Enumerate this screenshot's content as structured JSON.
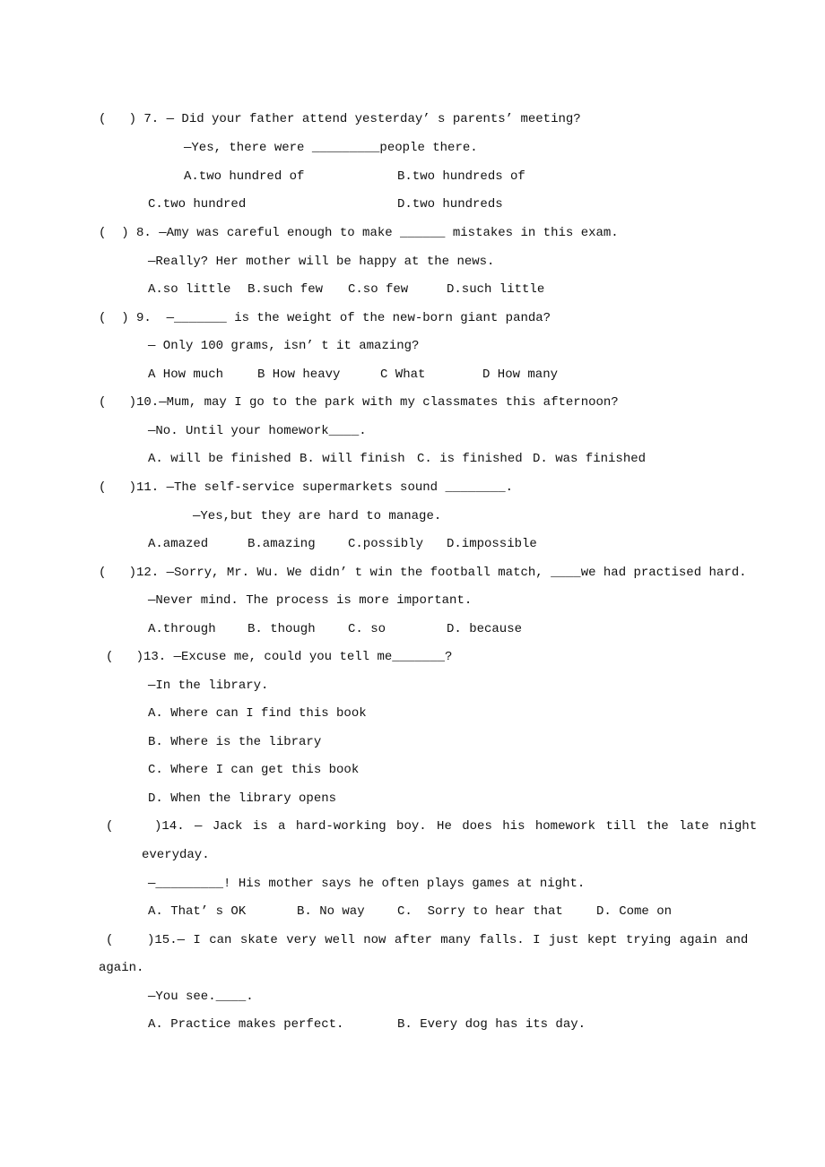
{
  "q7": {
    "stem": "(   ) 7. — Did your father attend yesterday’ s parents’ meeting?",
    "reply": "—Yes, there were _________people there.",
    "a": "A.two hundred of",
    "b": "B.two hundreds of",
    "c": "C.two hundred",
    "d": "D.two hundreds"
  },
  "q8": {
    "stem": "(  ) 8. —Amy was careful enough to make ______ mistakes in this exam.",
    "reply": "—Really? Her mother will be happy at the news.",
    "a": "A.so little",
    "b": "B.such few",
    "c": "C.so few",
    "d": "D.such little"
  },
  "q9": {
    "stem": "(  ) 9.  —_______ is the weight of the new-born giant panda?",
    "reply": "— Only 100 grams, isn’ t it amazing?",
    "a": "A How much",
    "b": "B How heavy",
    "c": "C What",
    "d": "D How many"
  },
  "q10": {
    "stem": "(   )10.—Mum, may I go to the park with my classmates this afternoon?",
    "reply": "—No. Until your homework____.",
    "a": "A. will be finished",
    "b": "B. will finish",
    "c": "C. is finished",
    "d": "D. was finished"
  },
  "q11": {
    "stem": "(   )11. —The self-service supermarkets sound ________.",
    "reply": "—Yes,but they are hard to manage.",
    "a": "A.amazed",
    "b": "B.amazing",
    "c": "C.possibly",
    "d": "D.impossible"
  },
  "q12": {
    "stem": "(   )12. —Sorry, Mr. Wu. We didn’ t win the football match, ____we had practised hard.",
    "reply": "—Never mind. The process is more important.",
    "a": "A.through",
    "b": "B. though",
    "c": "C. so",
    "d": "D. because"
  },
  "q13": {
    "stem": "(   )13. —Excuse me, could you tell me_______?",
    "reply": "—In the library.",
    "a": "A. Where can I find this book",
    "b": "B. Where is the library",
    "c": "C. Where I can get this book",
    "d": "D. When the library opens"
  },
  "q14": {
    "stem": "(    )14. — Jack is a hard-working boy. He does his homework till the late night",
    "stem2": "everyday.",
    "reply": "—_________! His mother says he often plays games at night.",
    "a": "A. That’ s OK",
    "b": "B. No way",
    "c": "C.  Sorry to hear that",
    "d": "D. Come on"
  },
  "q15": {
    "stem": "(    )15.— I can skate very well now after many falls. I just kept trying again and",
    "stem2": "again.",
    "reply": "—You see.____.",
    "a": "A. Practice makes perfect.",
    "b": "B. Every dog has its day."
  }
}
